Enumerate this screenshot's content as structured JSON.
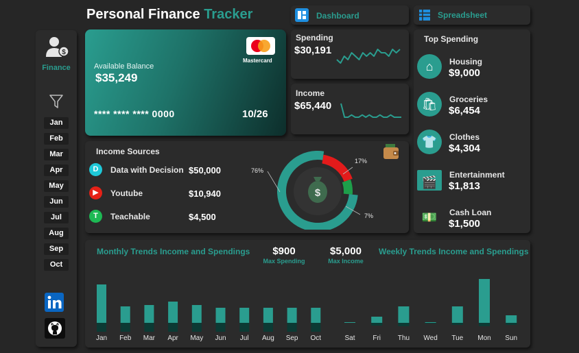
{
  "app": {
    "title_white": "Personal Finance",
    "title_teal": "Tracker"
  },
  "nav": {
    "dashboard_label": "Dashboard",
    "spreadsheet_label": "Spreadsheet"
  },
  "sidebar": {
    "finance_label": "Finance",
    "months": [
      "Jan",
      "Feb",
      "Mar",
      "Apr",
      "May",
      "Jun",
      "Jul",
      "Aug",
      "Sep",
      "Oct"
    ]
  },
  "card": {
    "balance_label": "Available Balance",
    "balance_value": "$35,249",
    "brand": "Mastercard",
    "number": "**** **** **** 0000",
    "expiry": "10/26"
  },
  "spending": {
    "label": "Spending",
    "value": "$30,191",
    "trend": [
      5,
      4,
      6,
      5,
      7,
      6,
      5,
      7,
      6,
      7,
      6,
      8,
      7,
      7,
      6,
      8,
      7,
      8
    ]
  },
  "income": {
    "label": "Income",
    "value": "$65,440",
    "trend": [
      9,
      3,
      3,
      4,
      3,
      3,
      4,
      3,
      4,
      3,
      3,
      4,
      3,
      3,
      4,
      3,
      3,
      3
    ]
  },
  "income_sources": {
    "title": "Income Sources",
    "items": [
      {
        "name": "Data with Decision",
        "value": "$50,000",
        "icon_letter": "D",
        "color": "#1ec8d8"
      },
      {
        "name": "Youtube",
        "value": "$10,940",
        "icon_letter": "▶",
        "color": "#e62117"
      },
      {
        "name": "Teachable",
        "value": "$4,500",
        "icon_letter": "T",
        "color": "#1db954"
      }
    ]
  },
  "donut": {
    "labels": [
      "76%",
      "17%",
      "7%"
    ],
    "values": [
      76,
      17,
      7
    ],
    "colors": [
      "#2a9d8f",
      "#e31b1b",
      "#1e9e4a"
    ]
  },
  "top_spending": {
    "title": "Top Spending",
    "items": [
      {
        "name": "Housing",
        "value": "$9,000",
        "icon": "house-icon"
      },
      {
        "name": "Groceries",
        "value": "$6,454",
        "icon": "shopping-bag-icon"
      },
      {
        "name": "Clothes",
        "value": "$4,304",
        "icon": "tshirt-icon"
      },
      {
        "name": "Entertainment",
        "value": "$1,813",
        "icon": "clapperboard-icon"
      },
      {
        "name": "Cash Loan",
        "value": "$1,500",
        "icon": "cash-hand-icon"
      }
    ]
  },
  "trends": {
    "monthly_title": "Monthly Trends Income and Spendings",
    "weekly_title": "Weekly Trends Income and Spendings",
    "max_spending_value": "$900",
    "max_spending_label": "Max Spending",
    "max_income_value": "$5,000",
    "max_income_label": "Max Income"
  },
  "chart_data": [
    {
      "type": "bar",
      "title": "Monthly Trends Income and Spendings",
      "categories": [
        "Jan",
        "Feb",
        "Mar",
        "Apr",
        "May",
        "Jun",
        "Jul",
        "Aug",
        "Sep",
        "Oct"
      ],
      "series": [
        {
          "values": [
            56,
            24,
            26,
            31,
            26,
            22,
            22,
            22,
            22,
            22
          ]
        },
        {
          "values": [
            13,
            13,
            13,
            13,
            13,
            13,
            13,
            13,
            13,
            13
          ]
        }
      ]
    },
    {
      "type": "bar",
      "title": "Weekly Trends Income and Spendings",
      "categories": [
        "Sat",
        "Fri",
        "Thu",
        "Wed",
        "Tue",
        "Mon",
        "Sun"
      ],
      "series": [
        {
          "values": [
            1,
            9,
            24,
            1,
            24,
            64,
            11
          ]
        },
        {
          "values": [
            0,
            4,
            5,
            1,
            3,
            5,
            3
          ]
        }
      ]
    }
  ],
  "colors": {
    "accent": "#2a9d8f",
    "background": "#262626",
    "panel": "#2b2b2b"
  }
}
